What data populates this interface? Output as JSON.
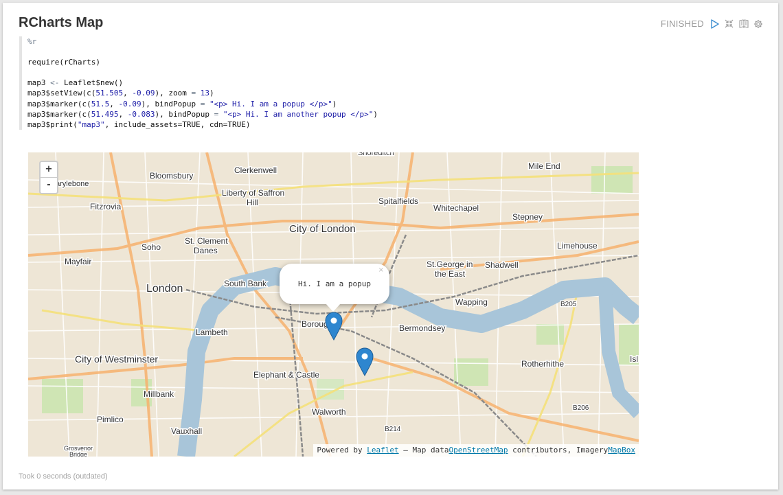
{
  "paragraph": {
    "title": "RCharts Map",
    "status": "FINISHED",
    "controls": [
      "run-icon",
      "hide-editor-icon",
      "show-output-icon",
      "settings-icon"
    ],
    "code_lines": [
      [
        {
          "t": "%r",
          "c": "op"
        }
      ],
      [
        {
          "t": "",
          "c": ""
        }
      ],
      [
        {
          "t": "require(rCharts)",
          "c": ""
        }
      ],
      [
        {
          "t": "",
          "c": ""
        }
      ],
      [
        {
          "t": "map3 ",
          "c": ""
        },
        {
          "t": "<-",
          "c": "op"
        },
        {
          "t": " Leaflet$new()",
          "c": ""
        }
      ],
      [
        {
          "t": "map3$setView(c(",
          "c": ""
        },
        {
          "t": "51.505",
          "c": "str"
        },
        {
          "t": ", ",
          "c": ""
        },
        {
          "t": "-0.09",
          "c": "str"
        },
        {
          "t": "), zoom ",
          "c": ""
        },
        {
          "t": "=",
          "c": "op"
        },
        {
          "t": " ",
          "c": ""
        },
        {
          "t": "13",
          "c": "str"
        },
        {
          "t": ")",
          "c": ""
        }
      ],
      [
        {
          "t": "map3$marker(c(",
          "c": ""
        },
        {
          "t": "51.5",
          "c": "str"
        },
        {
          "t": ", ",
          "c": ""
        },
        {
          "t": "-0.09",
          "c": "str"
        },
        {
          "t": "), bindPopup ",
          "c": ""
        },
        {
          "t": "=",
          "c": "op"
        },
        {
          "t": " ",
          "c": ""
        },
        {
          "t": "\"<p> Hi. I am a popup </p>\"",
          "c": "str"
        },
        {
          "t": ")",
          "c": ""
        }
      ],
      [
        {
          "t": "map3$marker(c(",
          "c": ""
        },
        {
          "t": "51.495",
          "c": "str"
        },
        {
          "t": ", ",
          "c": ""
        },
        {
          "t": "-0.083",
          "c": "str"
        },
        {
          "t": "), bindPopup ",
          "c": ""
        },
        {
          "t": "=",
          "c": "op"
        },
        {
          "t": " ",
          "c": ""
        },
        {
          "t": "\"<p> Hi. I am another popup </p>\"",
          "c": "str"
        },
        {
          "t": ")",
          "c": ""
        }
      ],
      [
        {
          "t": "map3$print(",
          "c": ""
        },
        {
          "t": "\"map3\"",
          "c": "str"
        },
        {
          "t": ", include_assets=TRUE, cdn=TRUE)",
          "c": ""
        }
      ]
    ],
    "footer": "Took 0 seconds (outdated)"
  },
  "map": {
    "zoom_in": "+",
    "zoom_out": "-",
    "popup_text": "Hi. I am a popup",
    "popup_close": "×",
    "attribution": {
      "prefix": "Powered by ",
      "leaflet": "Leaflet",
      "mid": " — Map data",
      "osm": "OpenStreetMap",
      "mid2": " contributors, Imagery",
      "mapbox": "MapBox"
    },
    "places": [
      {
        "name": "Clerkenwell",
        "k": "l1"
      },
      {
        "name": "Mile End",
        "k": "l2"
      },
      {
        "name": "arylebone",
        "k": "l3"
      },
      {
        "name": "Bloomsbury",
        "k": "l4"
      },
      {
        "name": "Liberty of Saffron",
        "k": "l5"
      },
      {
        "name": "Hill",
        "k": "l6"
      },
      {
        "name": "Spitalfields",
        "k": "l7"
      },
      {
        "name": "Whitechapel",
        "k": "l8"
      },
      {
        "name": "Fitzrovia",
        "k": "l9"
      },
      {
        "name": "Stepney",
        "k": "l10"
      },
      {
        "name": "City of London",
        "k": "l11"
      },
      {
        "name": "Soho",
        "k": "l12"
      },
      {
        "name": "St. Clement",
        "k": "l13"
      },
      {
        "name": "Danes",
        "k": "l14"
      },
      {
        "name": "Limehouse",
        "k": "l15"
      },
      {
        "name": "Mayfair",
        "k": "l16"
      },
      {
        "name": "St.George in",
        "k": "l17"
      },
      {
        "name": "the East",
        "k": "l18"
      },
      {
        "name": "Shadwell",
        "k": "l19"
      },
      {
        "name": "London",
        "k": "l20"
      },
      {
        "name": "South Bank",
        "k": "l21"
      },
      {
        "name": "Wapping",
        "k": "l22"
      },
      {
        "name": "Borough",
        "k": "l23"
      },
      {
        "name": "Bermondsey",
        "k": "l24"
      },
      {
        "name": "Lambeth",
        "k": "l25"
      },
      {
        "name": "City of Westminster",
        "k": "l26"
      },
      {
        "name": "Rotherhithe",
        "k": "l27"
      },
      {
        "name": "Elephant & Castle",
        "k": "l28"
      },
      {
        "name": "Millbank",
        "k": "l29"
      },
      {
        "name": "Walworth",
        "k": "l30"
      },
      {
        "name": "Pimlico",
        "k": "l31"
      },
      {
        "name": "Vauxhall",
        "k": "l32"
      },
      {
        "name": "B205",
        "k": "l33"
      },
      {
        "name": "B206",
        "k": "l34"
      },
      {
        "name": "B214",
        "k": "l35"
      },
      {
        "name": "Isl",
        "k": "l36"
      },
      {
        "name": "Grosvenor",
        "k": "l37"
      },
      {
        "name": "Bridge",
        "k": "l38"
      },
      {
        "name": "Shoreditch",
        "k": "l39"
      }
    ]
  }
}
